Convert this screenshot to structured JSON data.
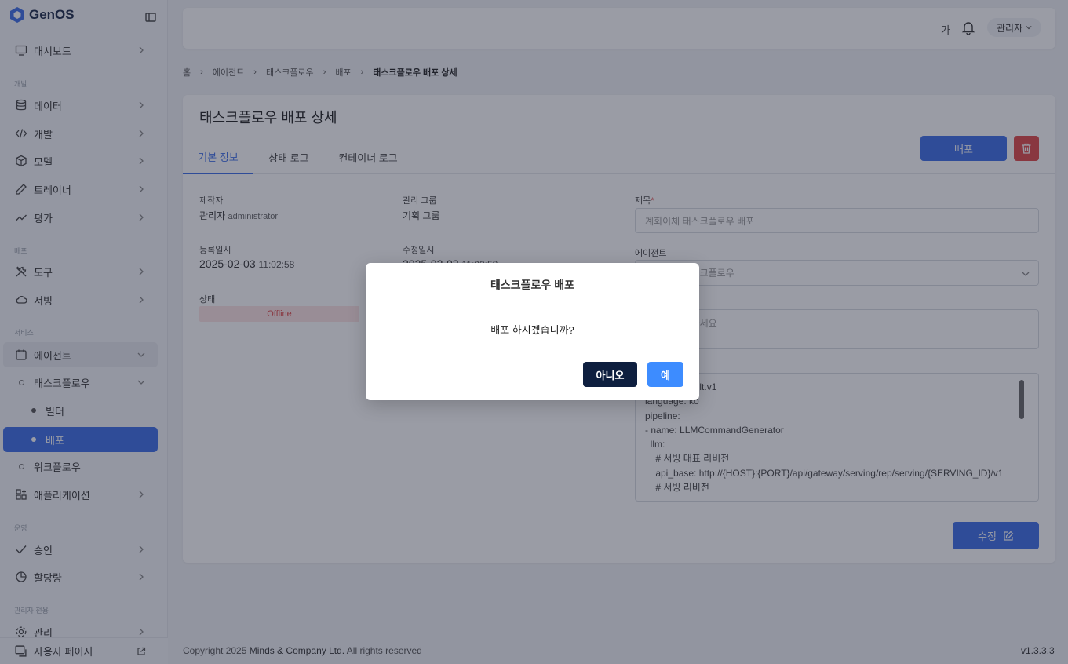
{
  "app": {
    "name": "GenOS"
  },
  "sidebar": {
    "dashboard": "대시보드",
    "section_dev": "개발",
    "data": "데이터",
    "develop": "개발",
    "model": "모델",
    "trainer": "트레이너",
    "eval": "평가",
    "section_deploy": "배포",
    "tools": "도구",
    "serving": "서빙",
    "section_service": "서비스",
    "agent": "에이전트",
    "taskflow": "태스크플로우",
    "builder": "빌더",
    "deploy": "배포",
    "workflow": "워크플로우",
    "application": "애플리케이션",
    "section_ops": "운영",
    "approval": "승인",
    "quota": "할당량",
    "section_admin": "관리자 전용",
    "admin": "관리",
    "user_page": "사용자 페이지"
  },
  "header": {
    "lang": "가",
    "user": "관리자"
  },
  "breadcrumb": {
    "home": "홈",
    "b1": "에이전트",
    "b2": "태스크플로우",
    "b3": "배포",
    "current": "태스크플로우 배포 상세"
  },
  "page": {
    "title": "태스크플로우 배포 상세",
    "tabs": [
      "기본 정보",
      "상태 로그",
      "컨테이너 로그"
    ],
    "deploy_button": "배포",
    "edit_button": "수정"
  },
  "info": {
    "creator_label": "제작자",
    "creator_value": "관리자",
    "creator_sub": "administrator",
    "group_label": "관리 그룹",
    "group_value": "기획 그룹",
    "created_label": "등록일시",
    "created_date": "2025-02-03",
    "created_time": "11:02:58",
    "updated_label": "수정일시",
    "updated_date": "2025-02-03",
    "updated_time": "11:02:58",
    "status_label": "상태",
    "status_value": "Offline"
  },
  "form": {
    "title_label": "제목",
    "title_required": "*",
    "title_value": "계회이체 태스크플로우 배포",
    "agent_label": "에이전트",
    "agent_value": "계회이체 태스크플로우",
    "desc_placeholder": "설명을 입력하세요",
    "config_lines": [
      "recipe: default.v1",
      "language: ko",
      "pipeline:",
      "- name: LLMCommandGenerator",
      "  llm:",
      "    # 서빙 대표 리비전",
      "    api_base: http://{HOST}:{PORT}/api/gateway/serving/rep/serving/{SERVING_ID}/v1",
      "    # 서빙 리비전"
    ]
  },
  "footer": {
    "copyright_prefix": "Copyright 2025 ",
    "company": "Minds & Company Ltd.",
    "copyright_suffix": " All rights reserved",
    "version": "v1.3.3.3"
  },
  "modal": {
    "title": "태스크플로우 배포",
    "message": "배포 하시겠습니까?",
    "no": "아니오",
    "yes": "예"
  }
}
